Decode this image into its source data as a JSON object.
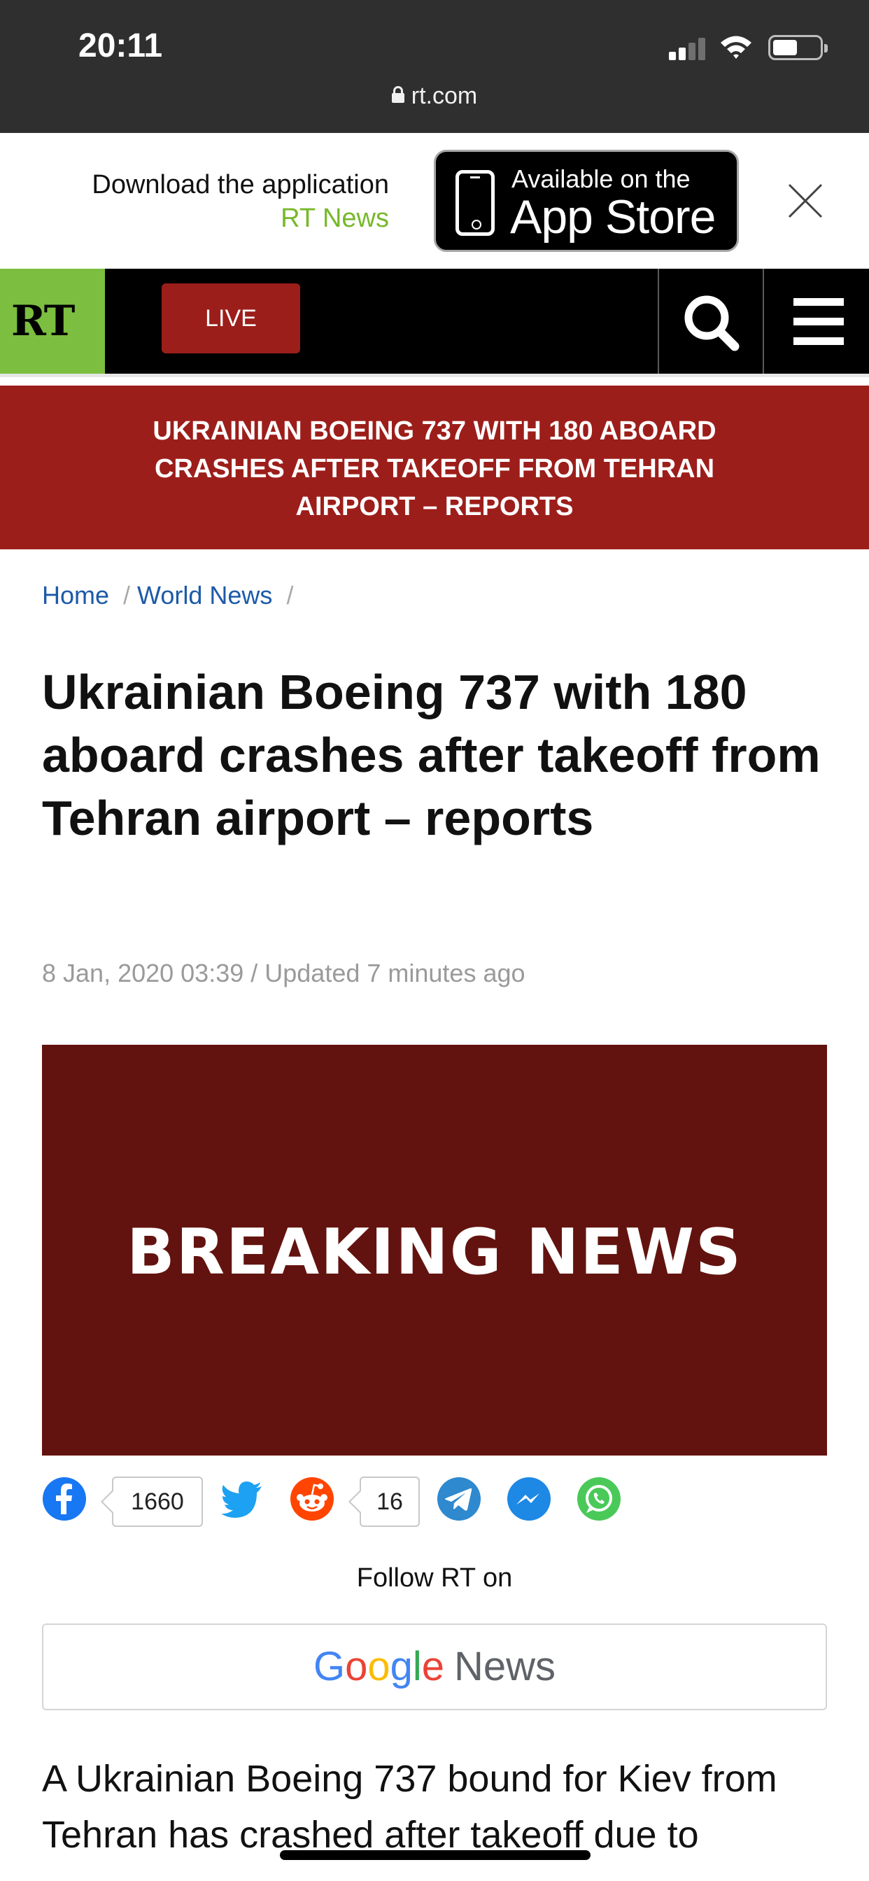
{
  "status_bar": {
    "time": "20:11",
    "url": "rt.com"
  },
  "app_banner": {
    "line1": "Download the application",
    "line2": "RT News",
    "store_small": "Available on the",
    "store_big": "App Store"
  },
  "nav": {
    "logo": "RT",
    "live_label": "LIVE"
  },
  "breaking_banner": "UKRAINIAN BOEING 737 WITH 180 ABOARD CRASHES AFTER TAKEOFF FROM TEHRAN AIRPORT – REPORTS",
  "breadcrumb": {
    "home": "Home",
    "section": "World News"
  },
  "article": {
    "headline": "Ukrainian Boeing 737 with 180 aboard crashes after takeoff from Tehran airport – reports",
    "dateline": "8 Jan, 2020 03:39 / Updated 7 minutes ago",
    "hero_text": "BREAKING NEWS",
    "body_line1": "A Ukrainian Boeing 737 bound for Kiev from",
    "body_line2": "Tehran has crashed after takeoff due to"
  },
  "share": {
    "facebook_count": "1660",
    "reddit_count": "16"
  },
  "follow": {
    "label": "Follow RT on",
    "google_letters": [
      "G",
      "o",
      "o",
      "g",
      "l",
      "e"
    ],
    "news_word": "News"
  },
  "colors": {
    "status_bg": "#2f2f2f",
    "brand_green": "#7cbe3f",
    "brand_red": "#9c1e1a",
    "hero_bg": "#63130f",
    "link_blue": "#1d5aa8"
  },
  "icons": [
    "lock-icon",
    "signal-icon",
    "wifi-icon",
    "battery-icon",
    "close-icon",
    "phone-icon",
    "search-icon",
    "menu-icon",
    "facebook-icon",
    "twitter-icon",
    "reddit-icon",
    "telegram-icon",
    "messenger-icon",
    "whatsapp-icon"
  ]
}
